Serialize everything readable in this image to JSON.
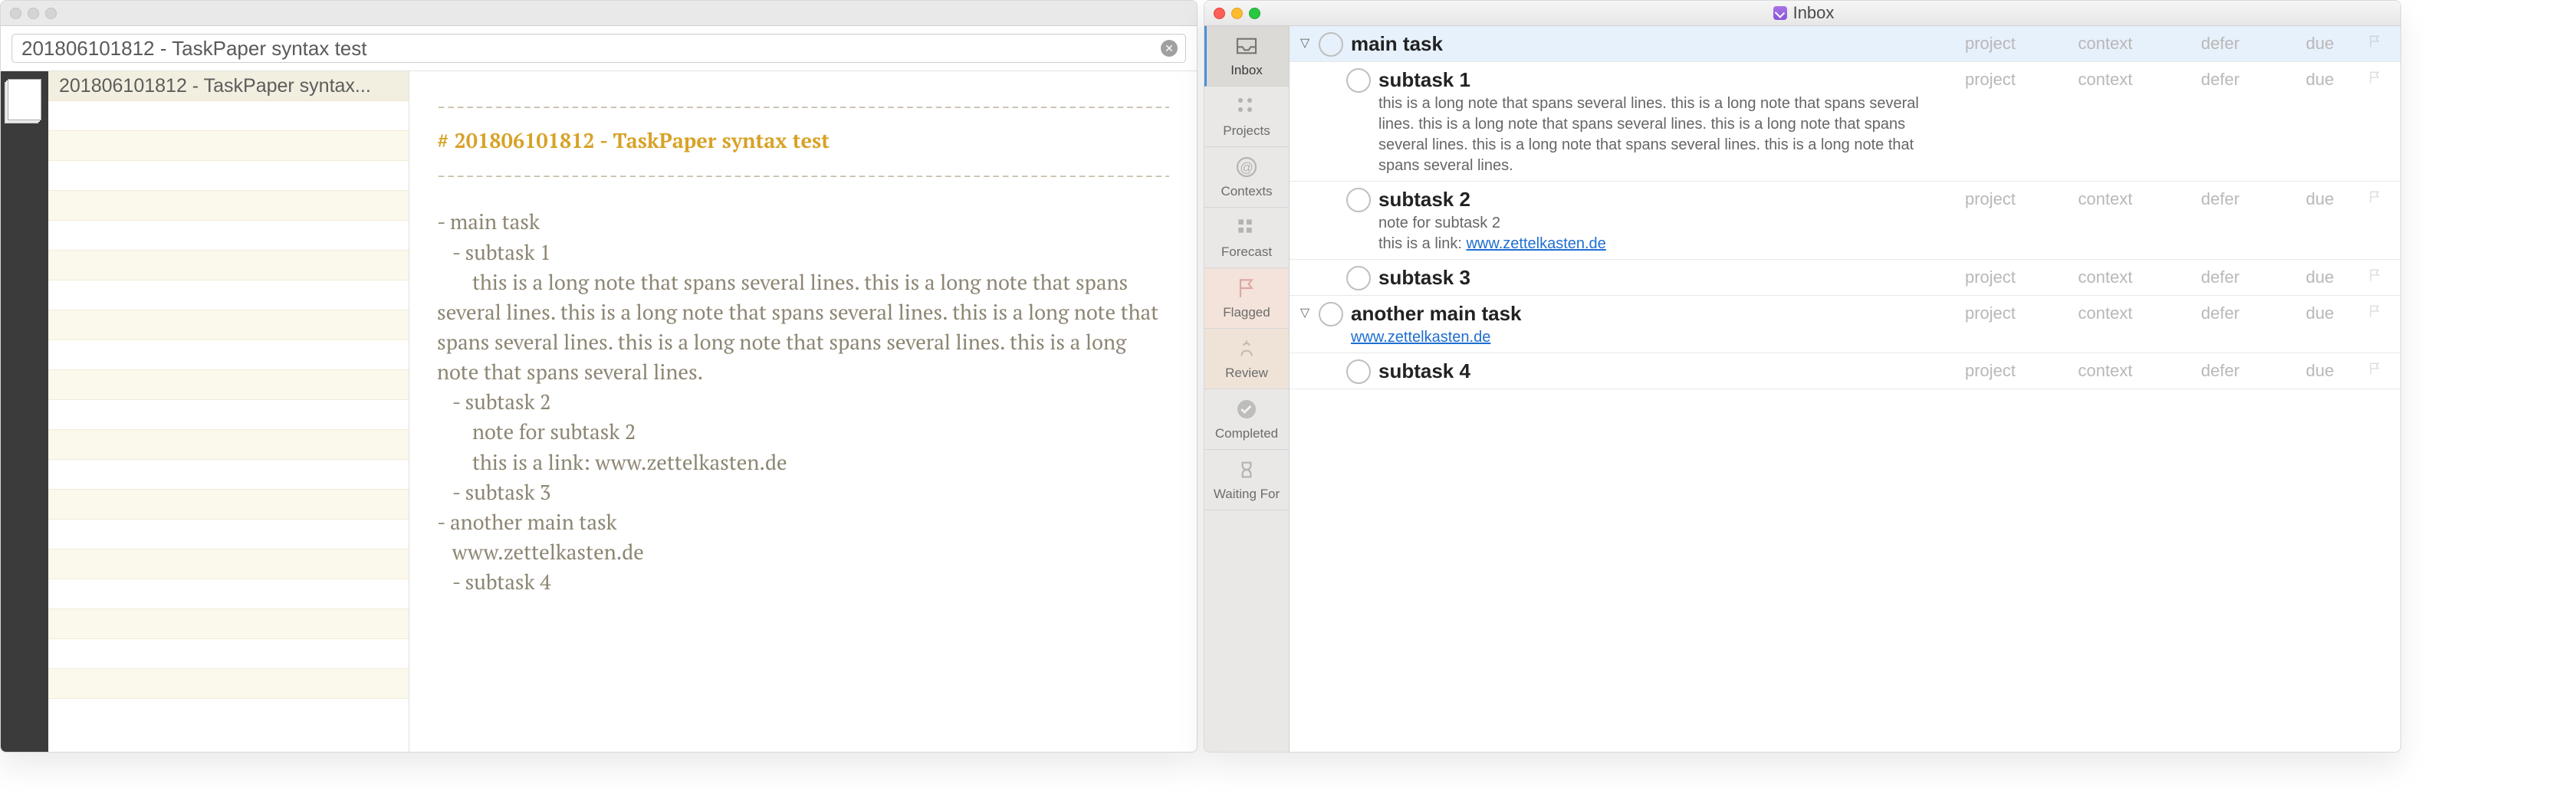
{
  "left": {
    "traffic_inactive": true,
    "search_value": "201806101812 - TaskPaper syntax test",
    "list_item": "201806101812 - TaskPaper syntax...",
    "divider": "-----------------------------------------------------------------------------------------",
    "title": "# 201806101812 - TaskPaper syntax test",
    "body": "- main task\n   - subtask 1\n       this is a long note that spans several lines. this is a long note that spans several lines. this is a long note that spans several lines. this is a long note that spans several lines. this is a long note that spans several lines. this is a long note that spans several lines.\n   - subtask 2\n       note for subtask 2\n       this is a link: www.zettelkasten.de\n   - subtask 3\n- another main task\n   www.zettelkasten.de\n   - subtask 4"
  },
  "right": {
    "window_title": "Inbox",
    "sidebar": [
      {
        "id": "inbox",
        "label": "Inbox"
      },
      {
        "id": "projects",
        "label": "Projects"
      },
      {
        "id": "contexts",
        "label": "Contexts"
      },
      {
        "id": "forecast",
        "label": "Forecast"
      },
      {
        "id": "flagged",
        "label": "Flagged"
      },
      {
        "id": "review",
        "label": "Review"
      },
      {
        "id": "completed",
        "label": "Completed"
      },
      {
        "id": "waiting",
        "label": "Waiting For"
      }
    ],
    "col_labels": {
      "project": "project",
      "context": "context",
      "defer": "defer",
      "due": "due"
    },
    "tasks": [
      {
        "name": "main task",
        "selected": true,
        "disclosure": true,
        "indent": 0
      },
      {
        "name": "subtask 1",
        "indent": 1,
        "note_plain": "this is a long note that spans several lines. this is a long note that spans several lines. this is a long note that spans several lines. this is a long note that spans several lines. this is a long note that spans several lines. this is a long note that spans several lines."
      },
      {
        "name": "subtask 2",
        "indent": 1,
        "note_plain": "note for subtask 2",
        "note_linkprefix": "this is a link: ",
        "note_link": "www.zettelkasten.de"
      },
      {
        "name": "subtask 3",
        "indent": 1
      },
      {
        "name": "another main task",
        "disclosure": true,
        "indent": 0,
        "link": "www.zettelkasten.de"
      },
      {
        "name": "subtask 4",
        "indent": 1
      }
    ]
  }
}
